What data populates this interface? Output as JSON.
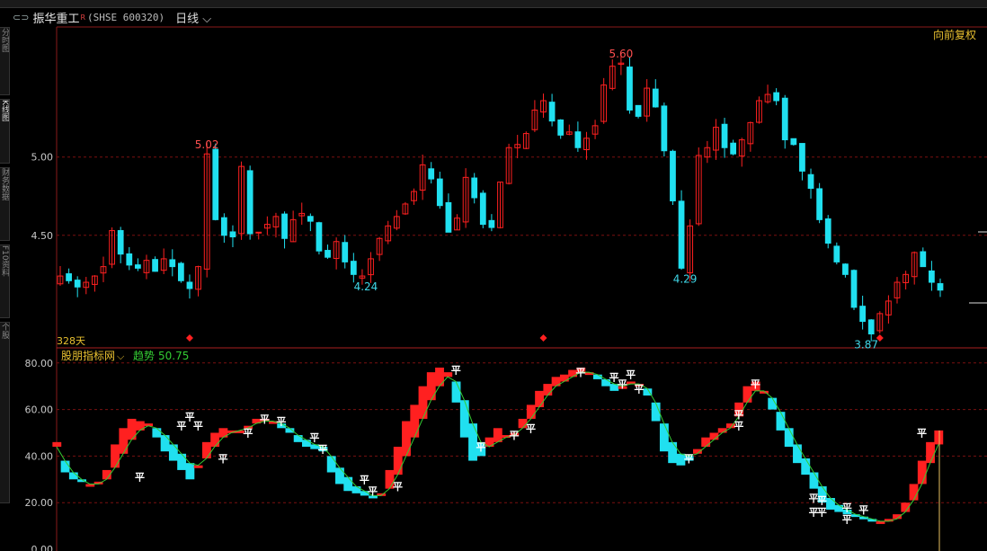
{
  "window": {
    "stock_name": "振华重工",
    "restore_mark": "R",
    "stock_code": "(SHSE 600320)",
    "period": "日线",
    "adjust_label": "向前复权",
    "days_label": "328天"
  },
  "left_tabs": [
    "分时图",
    "K线图",
    "财务数据",
    "F10资料",
    "个股"
  ],
  "colors": {
    "up": "#ff2020",
    "down": "#20e0f0",
    "grid": "#7a1010",
    "axis_text": "#c8c8c8",
    "trend": "#33cc33",
    "label_yellow": "#e8c030",
    "ping": "#ffffff",
    "diamond": "#ff2020"
  },
  "kline": {
    "y_ticks": [
      "5.00",
      "4.50"
    ],
    "y_tick_values": [
      5.0,
      4.5
    ],
    "ylim": [
      3.85,
      5.67
    ],
    "annotations": [
      {
        "text": "5.02",
        "value": 5.02,
        "index": 17,
        "color": "up"
      },
      {
        "text": "4.24",
        "value": 4.24,
        "index": 35,
        "color": "down"
      },
      {
        "text": "5.60",
        "value": 5.6,
        "index": 65,
        "color": "up"
      },
      {
        "text": "4.29",
        "value": 4.29,
        "index": 72,
        "color": "down"
      },
      {
        "text": "3.87",
        "value": 3.87,
        "index": 93,
        "color": "down"
      }
    ],
    "diamonds": [
      15,
      56,
      95
    ]
  },
  "indicator": {
    "name": "股朋指标网",
    "trend_label": "趋势",
    "trend_value": "50.75",
    "y_ticks": [
      "80.00",
      "60.00",
      "40.00",
      "20.00",
      "0.00"
    ],
    "y_tick_values": [
      80,
      60,
      40,
      20,
      0
    ],
    "ylim": [
      0,
      83
    ],
    "ping_text": "平",
    "ping_marks": [
      [
        10,
        31
      ],
      [
        16,
        57
      ],
      [
        15,
        53
      ],
      [
        17,
        53
      ],
      [
        20,
        39
      ],
      [
        23,
        50
      ],
      [
        25,
        56
      ],
      [
        27,
        55
      ],
      [
        31,
        48
      ],
      [
        32,
        43
      ],
      [
        37,
        30
      ],
      [
        38,
        25
      ],
      [
        41,
        27
      ],
      [
        48,
        77
      ],
      [
        51,
        44
      ],
      [
        55,
        49
      ],
      [
        57,
        52
      ],
      [
        63,
        76
      ],
      [
        67,
        74
      ],
      [
        68,
        71
      ],
      [
        69,
        75
      ],
      [
        70,
        69
      ],
      [
        76,
        39
      ],
      [
        82,
        58
      ],
      [
        82,
        53
      ],
      [
        84,
        71
      ],
      [
        91,
        22
      ],
      [
        92,
        21
      ],
      [
        91,
        16
      ],
      [
        92,
        16
      ],
      [
        95,
        18
      ],
      [
        95,
        13
      ],
      [
        97,
        17
      ],
      [
        104,
        50
      ]
    ]
  },
  "chart_data": [
    {
      "type": "candlestick",
      "title": "",
      "ylim": [
        3.85,
        5.67
      ],
      "series": [
        {
          "name": "",
          "values": [
            4.24,
            4.21,
            4.17,
            4.2,
            4.24,
            4.3,
            4.53,
            4.38,
            4.31,
            4.29,
            4.34,
            4.27,
            4.35,
            4.3,
            4.21,
            4.16,
            4.3,
            5.02,
            4.6,
            4.5,
            4.49,
            4.94,
            4.51,
            4.52,
            4.57,
            4.62,
            4.48,
            4.6,
            4.64,
            4.59,
            4.4,
            4.36,
            4.46,
            4.33,
            4.25,
            4.24,
            4.35,
            4.48,
            4.56,
            4.62,
            4.7,
            4.78,
            4.95,
            4.86,
            4.69,
            4.52,
            4.61,
            4.87,
            4.74,
            4.57,
            4.55,
            4.84,
            5.06,
            5.08,
            5.15,
            5.3,
            5.36,
            5.23,
            5.14,
            5.16,
            5.06,
            5.12,
            5.2,
            5.46,
            5.58,
            5.6,
            5.3,
            5.26,
            5.44,
            5.32,
            5.04,
            4.72,
            4.29,
            4.56,
            5.01,
            5.06,
            5.19,
            5.06,
            5.02,
            5.11,
            5.22,
            5.36,
            5.4,
            5.36,
            5.11,
            5.08,
            4.91,
            4.8,
            4.6,
            4.45,
            4.33,
            4.25,
            4.04,
            3.95,
            3.87,
            4.0,
            4.08,
            4.2,
            4.25,
            4.39,
            4.3,
            4.2,
            4.15
          ]
        }
      ]
    },
    {
      "type": "line",
      "title": "",
      "ylim": [
        0,
        83
      ],
      "series": [
        {
          "name": "",
          "values": [
            46,
            33,
            30,
            29,
            28,
            29,
            34,
            45,
            52,
            56,
            55,
            54,
            48,
            42,
            38,
            34,
            30,
            36,
            46,
            50,
            52,
            51,
            51,
            53,
            56,
            56,
            55,
            52,
            50,
            46,
            44,
            43,
            42,
            33,
            28,
            25,
            24,
            23,
            22,
            24,
            34,
            44,
            55,
            62,
            70,
            76,
            78,
            76,
            63,
            48,
            38,
            40,
            48,
            52,
            49,
            50,
            56,
            62,
            68,
            71,
            74,
            75,
            77,
            78,
            76,
            73,
            70,
            68,
            70,
            72,
            71,
            66,
            55,
            42,
            37,
            36,
            38,
            43,
            48,
            50,
            52,
            54,
            63,
            70,
            72,
            68,
            60,
            51,
            44,
            37,
            32,
            26,
            20,
            17,
            16,
            15,
            14,
            13,
            12,
            12,
            13,
            15,
            20,
            28,
            38,
            46,
            51
          ]
        },
        {
          "name": "趋势",
          "values": [
            44,
            38,
            33,
            30,
            28,
            28,
            30,
            35,
            41,
            47,
            51,
            53,
            52,
            49,
            45,
            41,
            37,
            36,
            39,
            44,
            48,
            50,
            51,
            52,
            54,
            55,
            55,
            54,
            52,
            49,
            47,
            45,
            44,
            40,
            35,
            31,
            27,
            25,
            23,
            23,
            26,
            32,
            40,
            48,
            56,
            64,
            70,
            74,
            72,
            64,
            54,
            46,
            44,
            46,
            48,
            49,
            52,
            56,
            61,
            66,
            70,
            72,
            74,
            76,
            76,
            75,
            73,
            71,
            70,
            71,
            71,
            69,
            63,
            54,
            46,
            41,
            40,
            41,
            44,
            47,
            50,
            52,
            57,
            63,
            68,
            68,
            65,
            59,
            52,
            45,
            39,
            33,
            27,
            22,
            19,
            17,
            15,
            14,
            13,
            12,
            12,
            13,
            16,
            21,
            28,
            37,
            45
          ]
        }
      ]
    }
  ]
}
